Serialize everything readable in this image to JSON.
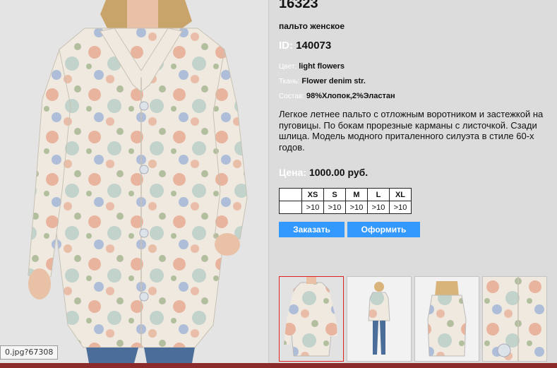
{
  "product": {
    "number": "16323",
    "type": "пальто женское",
    "id_label": "ID:",
    "id_value": "140073",
    "color_label": "Цвет:",
    "color_value": "light flowers",
    "fabric_label": "Ткань:",
    "fabric_value": "Flower denim str.",
    "composition_label": "Состав:",
    "composition_value": "98%Хлопок,2%Эластан",
    "description": "Легкое летнее пальто с отложным воротником и застежкой на пуговицы. По бокам прорезные карманы с листочкой. Сзади шлица. Модель модного приталенного силуэта в стиле 60-х годов.",
    "price_label": "Цена:",
    "price_value": "1000.00 руб."
  },
  "sizes": [
    {
      "size": "XS",
      "qty": ">10"
    },
    {
      "size": "S",
      "qty": ">10"
    },
    {
      "size": "M",
      "qty": ">10"
    },
    {
      "size": "L",
      "qty": ">10"
    },
    {
      "size": "XL",
      "qty": ">10"
    }
  ],
  "buttons": {
    "order": "Заказать",
    "checkout": "Оформить"
  },
  "url_tooltip": "0.jpg?67308",
  "colors": {
    "accent": "#3399ff",
    "panel_bg": "#dcdcdc",
    "label": "#ffffff",
    "active_thumb_border": "#dd2222"
  }
}
